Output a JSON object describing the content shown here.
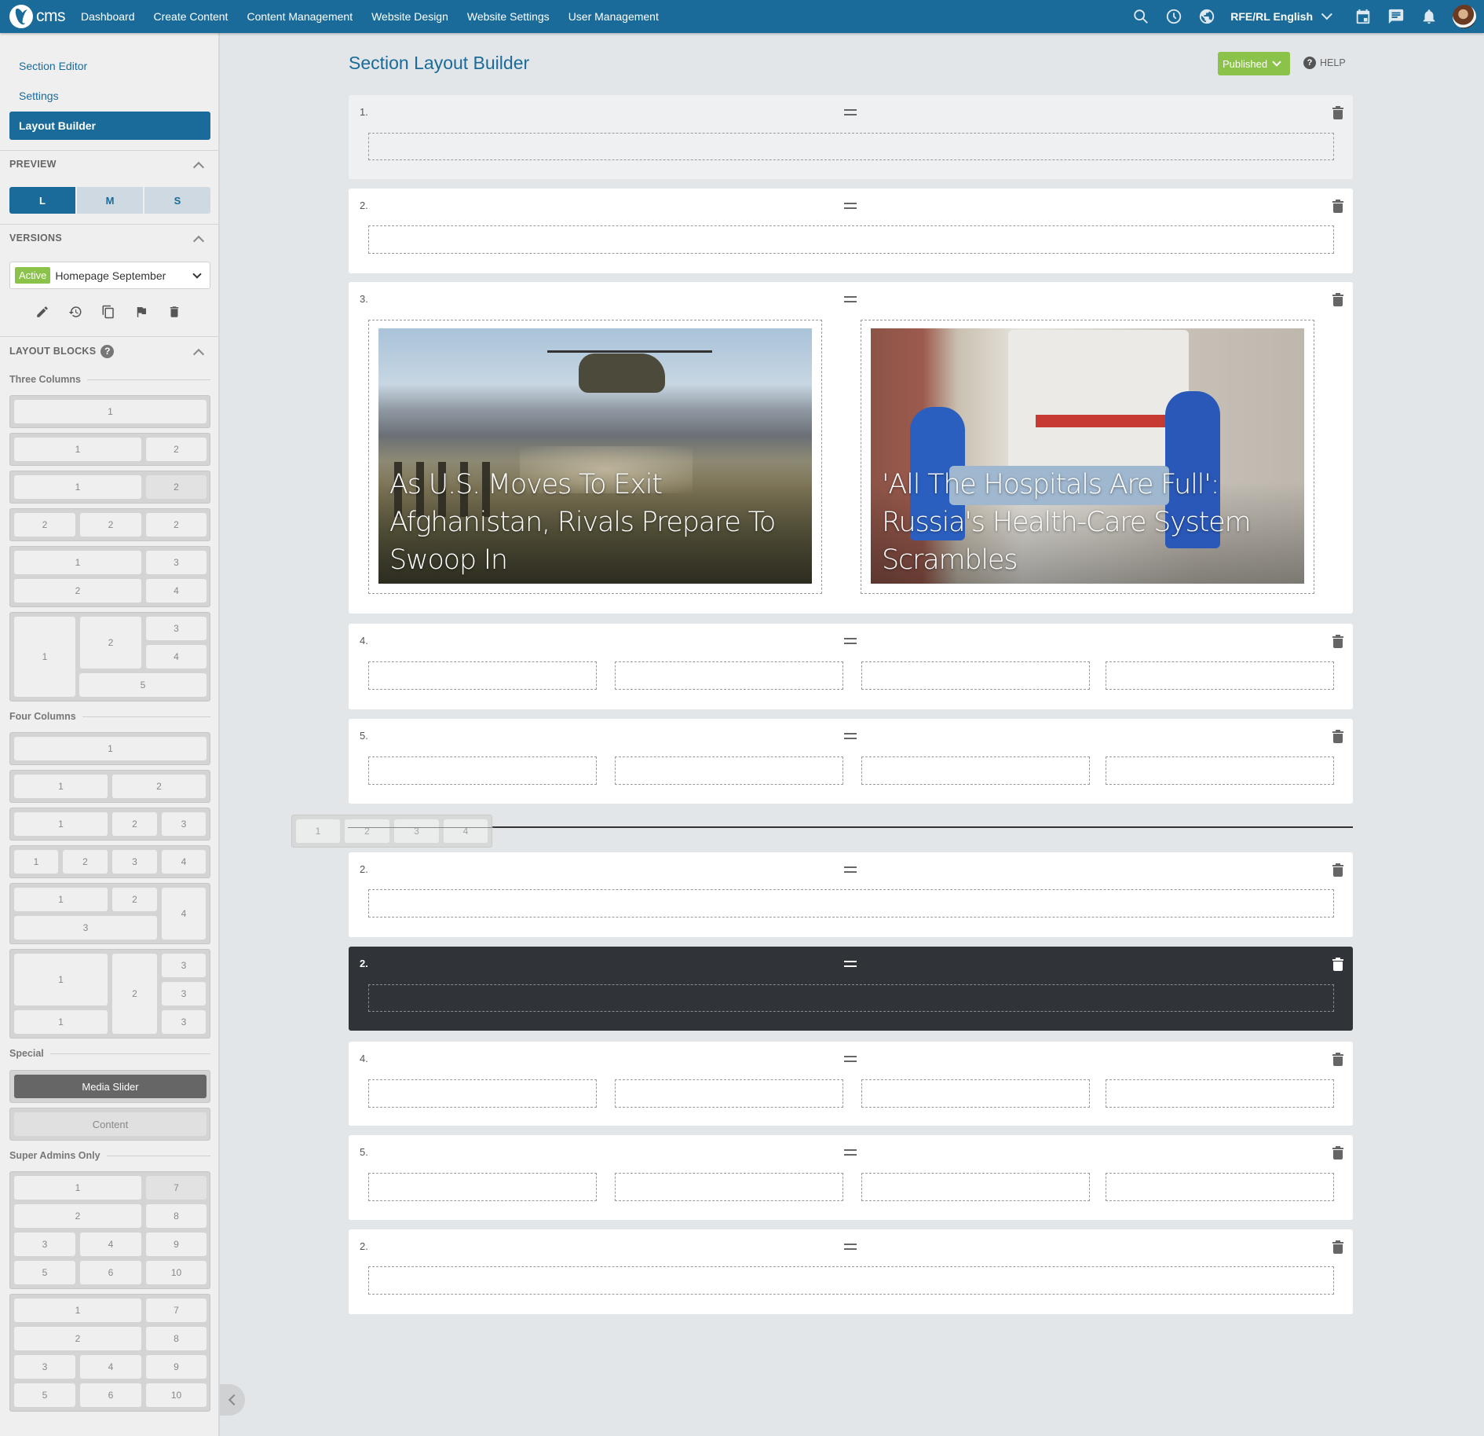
{
  "topbar": {
    "logo_text": "cms",
    "nav": [
      "Dashboard",
      "Create Content",
      "Content Management",
      "Website Design",
      "Website Settings",
      "User Management"
    ],
    "icons": [
      "search-icon",
      "history-clock-icon",
      "globe-icon"
    ],
    "language": "RFE/RL English",
    "right_icons": [
      "calendar-icon",
      "messages-icon",
      "notifications-bell-icon"
    ],
    "avatar": "user-avatar"
  },
  "sidebar": {
    "links": [
      "Section Editor",
      "Settings"
    ],
    "active_link": "Layout Builder",
    "preview": {
      "title": "PREVIEW",
      "sizes": [
        "L",
        "M",
        "S"
      ],
      "selected": "L"
    },
    "versions": {
      "title": "VERSIONS",
      "badge": "Active",
      "selected": "Homepage September",
      "actions": [
        "edit-icon",
        "restore-history-icon",
        "copy-icon",
        "flag-icon",
        "delete-icon"
      ]
    },
    "layout_blocks": {
      "title": "LAYOUT BLOCKS",
      "help": "?",
      "groups": {
        "three_columns": "Three Columns",
        "four_columns": "Four Columns",
        "special": "Special",
        "super_admins": "Super Admins Only"
      },
      "special_items": [
        "Media Slider",
        "Content"
      ],
      "cells": {
        "n1": "1",
        "n2": "2",
        "n3": "3",
        "n4": "4",
        "n5": "5",
        "n6": "6",
        "n7": "7",
        "n8": "8",
        "n9": "9",
        "n10": "10"
      }
    }
  },
  "main": {
    "title": "Section Layout Builder",
    "status": "Published",
    "help": "HELP",
    "rows": [
      {
        "label": "1."
      },
      {
        "label": "2."
      },
      {
        "label": "3.",
        "cards": [
          {
            "caption": "As U.S. Moves To Exit Afghanistan, Rivals Prepare To Swoop In"
          },
          {
            "caption": "'All The Hospitals Are Full': Russia's Health-Care System Scrambles"
          }
        ]
      },
      {
        "label": "4."
      },
      {
        "label": "5."
      },
      {
        "label": "2."
      },
      {
        "label": "2.",
        "selected": true
      },
      {
        "label": "4."
      },
      {
        "label": "5."
      },
      {
        "label": "2."
      }
    ],
    "drag_ghost": [
      "1",
      "2",
      "3",
      "4"
    ]
  }
}
